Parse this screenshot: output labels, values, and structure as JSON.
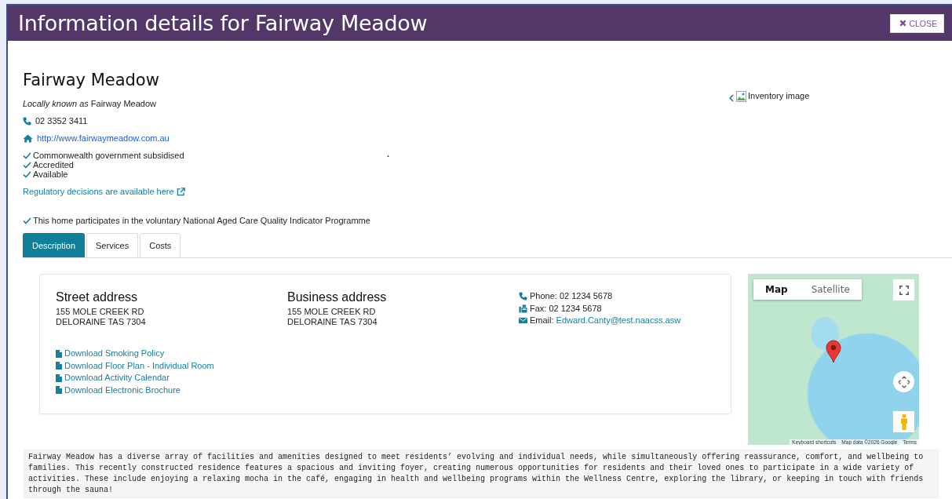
{
  "header": {
    "title": "Information details for Fairway Meadow",
    "close_label": "CLOSE"
  },
  "facility": {
    "name": "Fairway Meadow",
    "locally_known": "*Locally known as* Fairway Meadow",
    "phone": "02 3352 3411",
    "website": "http://www.fairwaymeadow.com.au",
    "features": [
      "Commonwealth government subsidised",
      "Accredited",
      "Available"
    ],
    "stray_mark": ".",
    "regulatory_link": "Regulatory decisions are available here",
    "quality_indicator": "This home participates in the voluntary National Aged Care Quality Indicator Programme"
  },
  "gallery": {
    "image_alt": "Inventory image"
  },
  "tabs": [
    {
      "label": "Description",
      "selected": true
    },
    {
      "label": "Services",
      "selected": false
    },
    {
      "label": "Costs",
      "selected": false
    }
  ],
  "addresses": [
    {
      "heading": "Street address",
      "lines": [
        "155 MOLE CREEK RD",
        "DELORAINE TAS 7304"
      ]
    },
    {
      "heading": "Business address",
      "lines": [
        "155 MOLE CREEK RD",
        "DELORAINE TAS 7304"
      ]
    }
  ],
  "downloads": [
    "Download Smoking Policy",
    "Download Floor Plan - Individual Room",
    "Download Activity Calendar",
    "Download Electronic Brochure"
  ],
  "contacts": [
    {
      "kind": "phone",
      "label": "Phone:",
      "value": "02  1234 5678"
    },
    {
      "kind": "fax",
      "label": "Fax:",
      "value": "02  1234 5678"
    },
    {
      "kind": "email",
      "label": "Email:",
      "value": "Edward.Canty@test.naacss.asw"
    }
  ],
  "map": {
    "map_types": [
      {
        "label": "Map",
        "selected": true
      },
      {
        "label": "Satellite",
        "selected": false
      }
    ],
    "attribution": [
      "Keyboard shortcuts",
      "Map data ©2026 Google",
      "Terms"
    ]
  },
  "description": "Fairway Meadow has a diverse array of facilities and amenities designed to meet residents’ evolving and individual needs, while simultaneously offering reassurance, comfort, and wellbeing to families. This recently constructed residence features a spacious and inviting foyer, creating numerous opportunities for residents and their loved ones to participate in a wide variety of activities. These include enjoying a relaxing mocha in the café, engaging in health and wellbeing programs within the Wellness Centre, exploring the library, or keeping in touch with friends through the sauna!"
}
